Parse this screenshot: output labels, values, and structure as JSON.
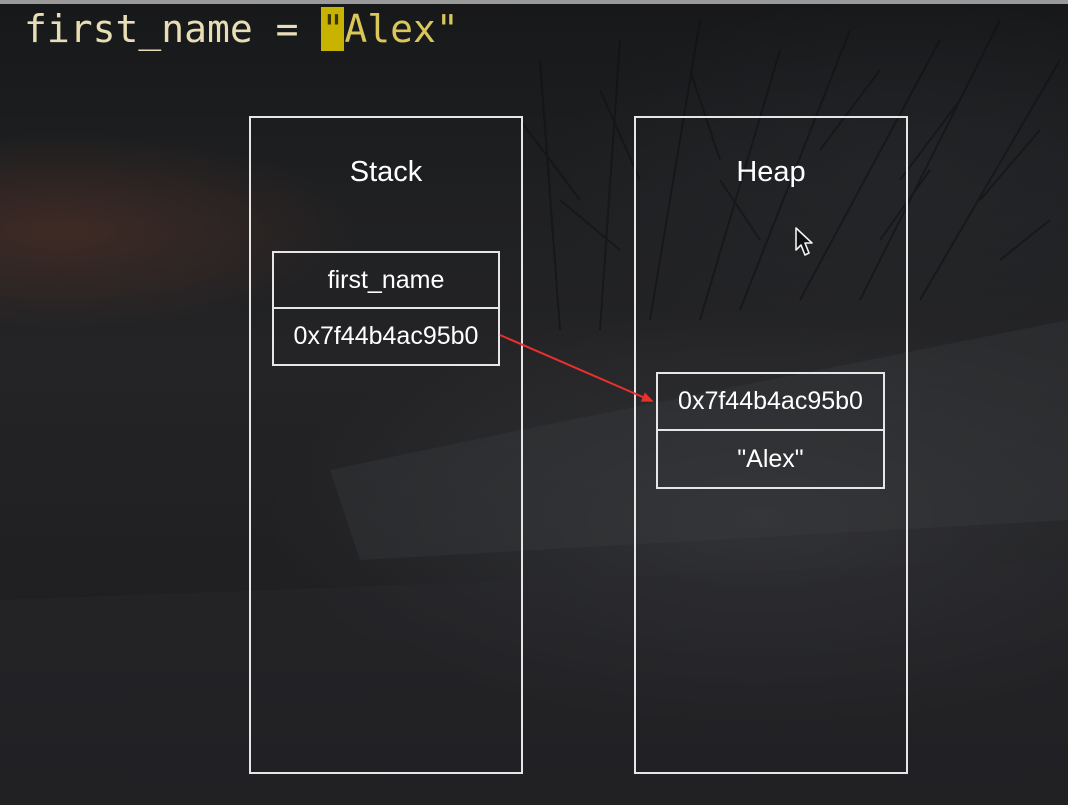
{
  "code": {
    "identifier": "first_name",
    "operator": "=",
    "string_open_quote": "\"",
    "string_rest": "Alex\""
  },
  "stack": {
    "title": "Stack",
    "variable_name": "first_name",
    "variable_address": "0x7f44b4ac95b0"
  },
  "heap": {
    "title": "Heap",
    "object_address": "0x7f44b4ac95b0",
    "object_value": "\"Alex\""
  },
  "colors": {
    "arrow": "#e8302c",
    "box_stroke": "#e6e6e6",
    "code_text": "#e8ddb4",
    "string_text": "#d9c75a",
    "cursor_highlight": "#c8b400"
  },
  "icons": {
    "pointer": "mouse-cursor-icon"
  }
}
